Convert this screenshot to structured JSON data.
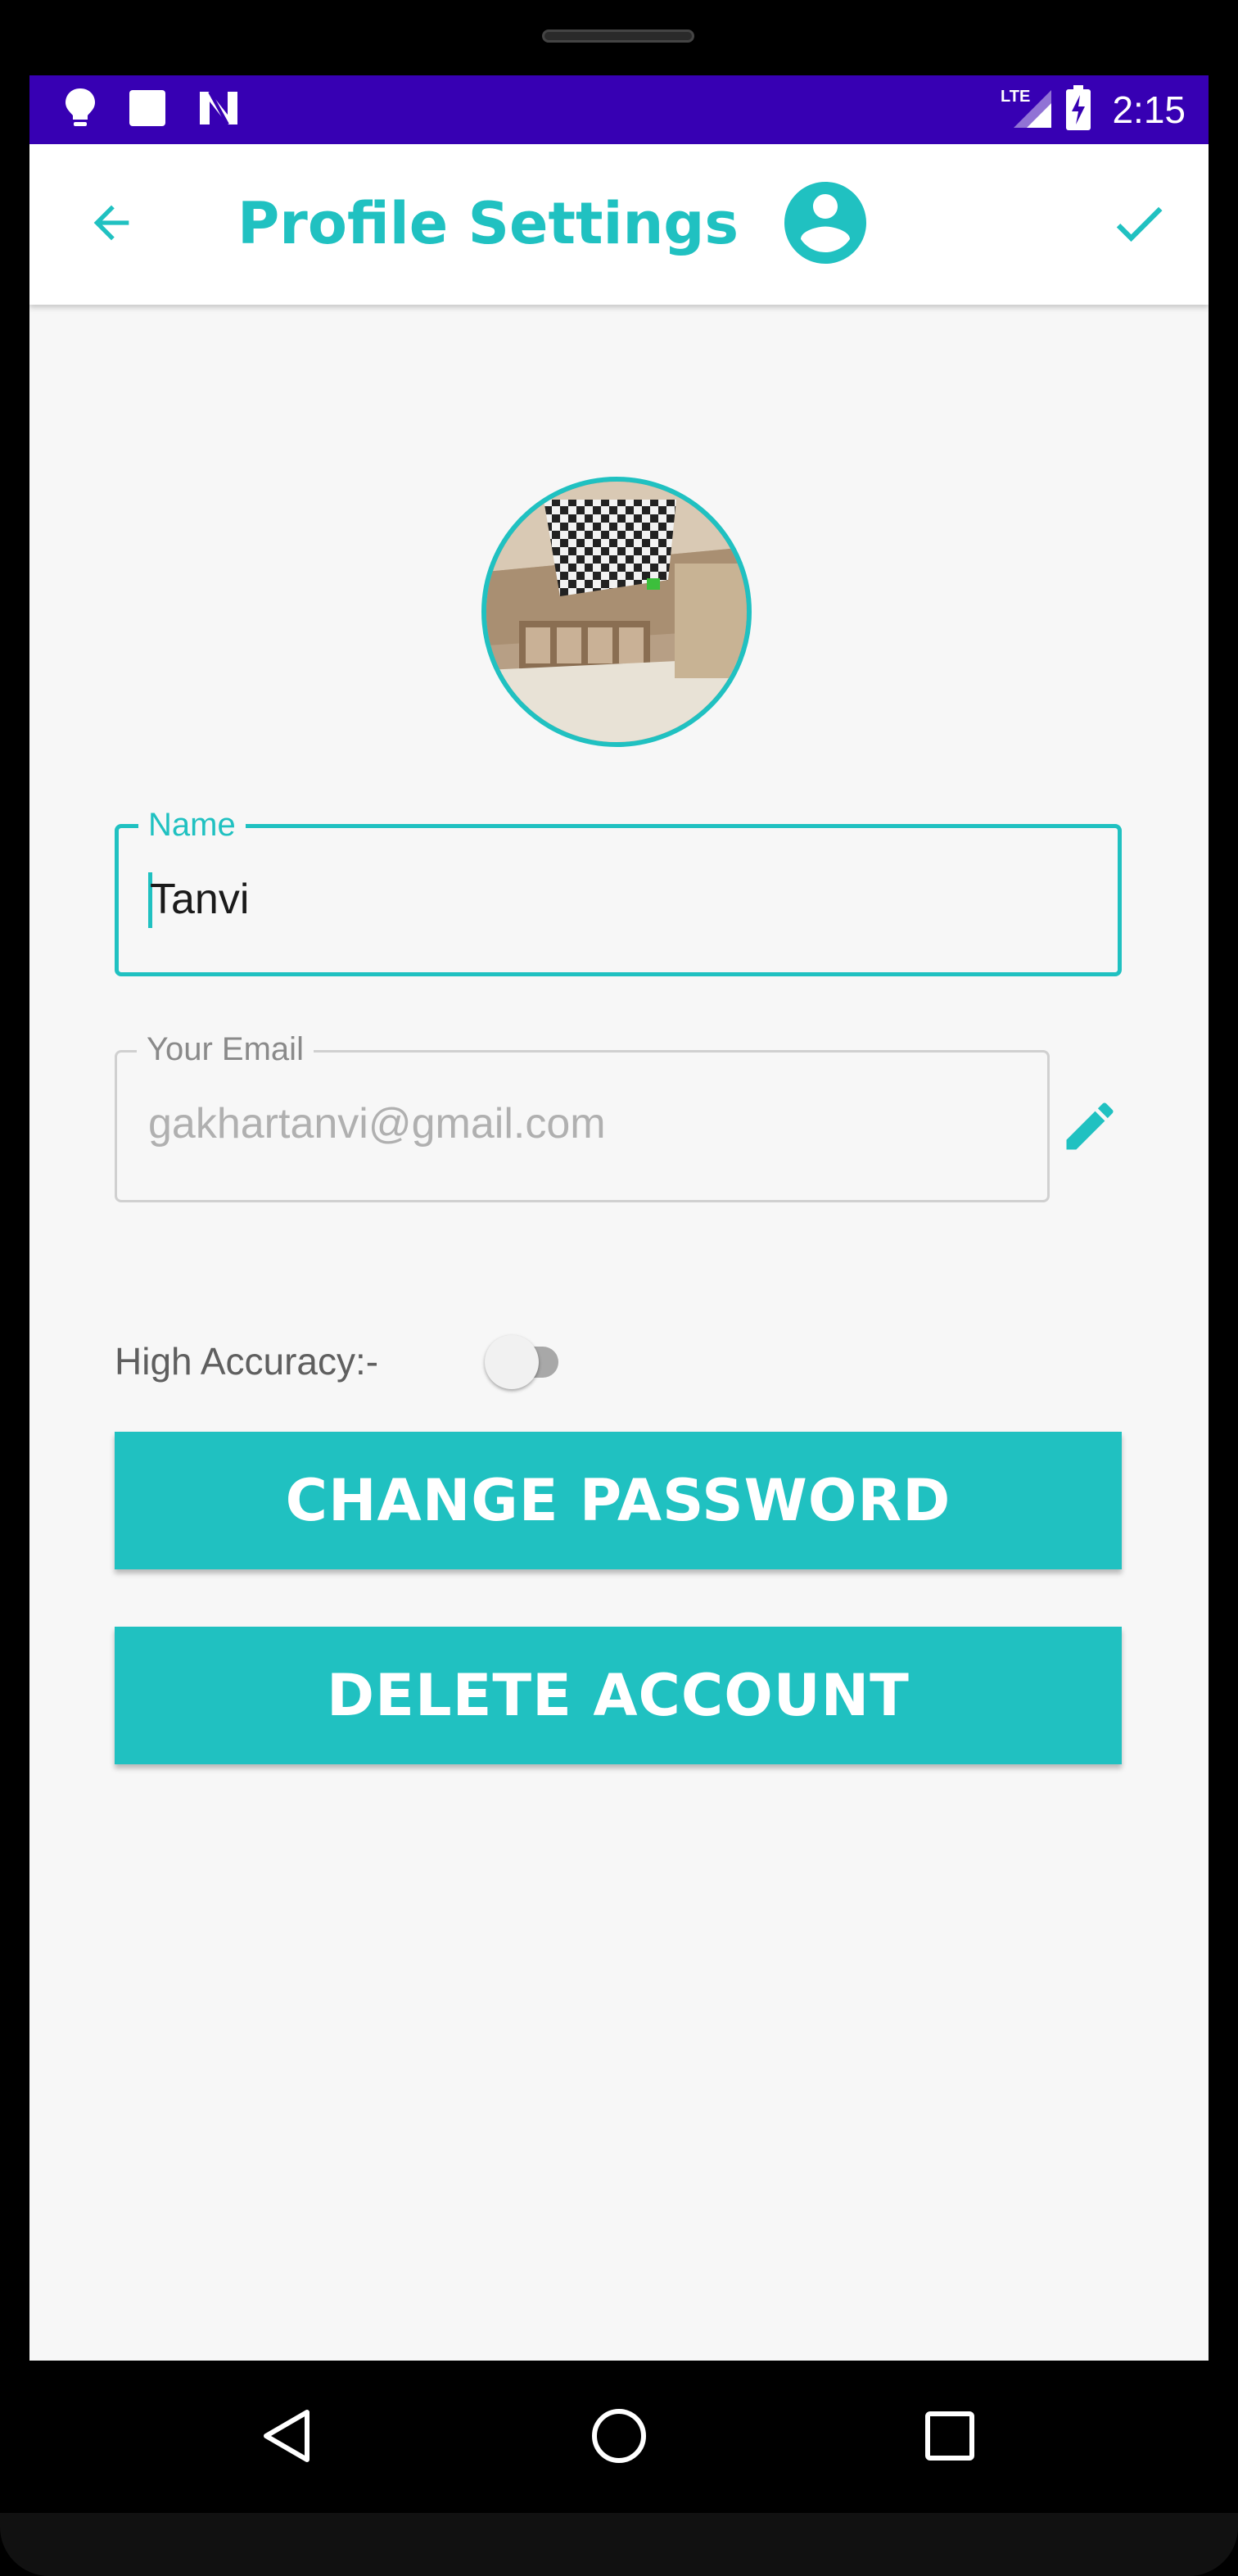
{
  "status_bar": {
    "time": "2:15",
    "network_label": "LTE",
    "icons": [
      "lightbulb-icon",
      "square-icon",
      "n-icon",
      "lte-signal-icon",
      "battery-charging-icon"
    ]
  },
  "app_bar": {
    "title": "Profile Settings",
    "back_icon": "arrow-back-icon",
    "avatar_icon": "account-circle-icon",
    "confirm_icon": "check-icon"
  },
  "profile": {
    "photo": "profile-photo"
  },
  "form": {
    "name_label": "Name",
    "name_value": "Tanvi",
    "email_label": "Your Email",
    "email_value": "gakhartanvi@gmail.com",
    "edit_icon": "pencil-icon",
    "accuracy_label": "High Accuracy:-",
    "accuracy_enabled": false
  },
  "buttons": {
    "change_password": "CHANGE PASSWORD",
    "delete_account": "DELETE ACCOUNT"
  },
  "nav_bar": {
    "icons": [
      "nav-back-icon",
      "nav-home-icon",
      "nav-recents-icon"
    ]
  },
  "colors": {
    "accent": "#20c1c1",
    "status_bar": "#3700b3",
    "background": "#f7f7f7"
  }
}
